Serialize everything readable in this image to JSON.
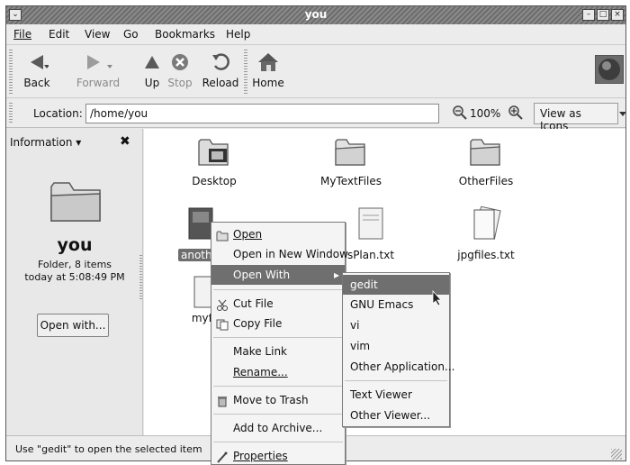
{
  "window": {
    "title": "you"
  },
  "menubar": {
    "file": "File",
    "edit": "Edit",
    "view": "View",
    "go": "Go",
    "bookmarks": "Bookmarks",
    "help": "Help"
  },
  "toolbar": {
    "back": "Back",
    "forward": "Forward",
    "up": "Up",
    "stop": "Stop",
    "reload": "Reload",
    "home": "Home"
  },
  "location": {
    "label": "Location:",
    "value": "/home/you",
    "zoom": "100%",
    "view_mode": "View as Icons"
  },
  "sidepane": {
    "header": "Information",
    "folder_name": "you",
    "type_count": "Folder, 8 items",
    "modified": "today at 5:08:49 PM",
    "open_with_button": "Open with..."
  },
  "files": [
    {
      "name": "Desktop"
    },
    {
      "name": "MyTextFiles"
    },
    {
      "name": "OtherFiles"
    },
    {
      "name": "anothe"
    },
    {
      "name": "sPlan.txt"
    },
    {
      "name": "jpgfiles.txt"
    },
    {
      "name": "myfi"
    }
  ],
  "context_menu": {
    "open": "Open",
    "open_new_window": "Open in New Window",
    "open_with": "Open With",
    "cut_file": "Cut File",
    "copy_file": "Copy File",
    "make_link": "Make Link",
    "rename": "Rename...",
    "move_to_trash": "Move to Trash",
    "add_to_archive": "Add to Archive...",
    "properties": "Properties"
  },
  "open_with_submenu": {
    "gedit": "gedit",
    "gnu_emacs": "GNU Emacs",
    "vi": "vi",
    "vim": "vim",
    "other_application": "Other Application...",
    "text_viewer": "Text Viewer",
    "other_viewer": "Other Viewer..."
  },
  "statusbar": {
    "text": "Use \"gedit\" to open the selected item"
  }
}
